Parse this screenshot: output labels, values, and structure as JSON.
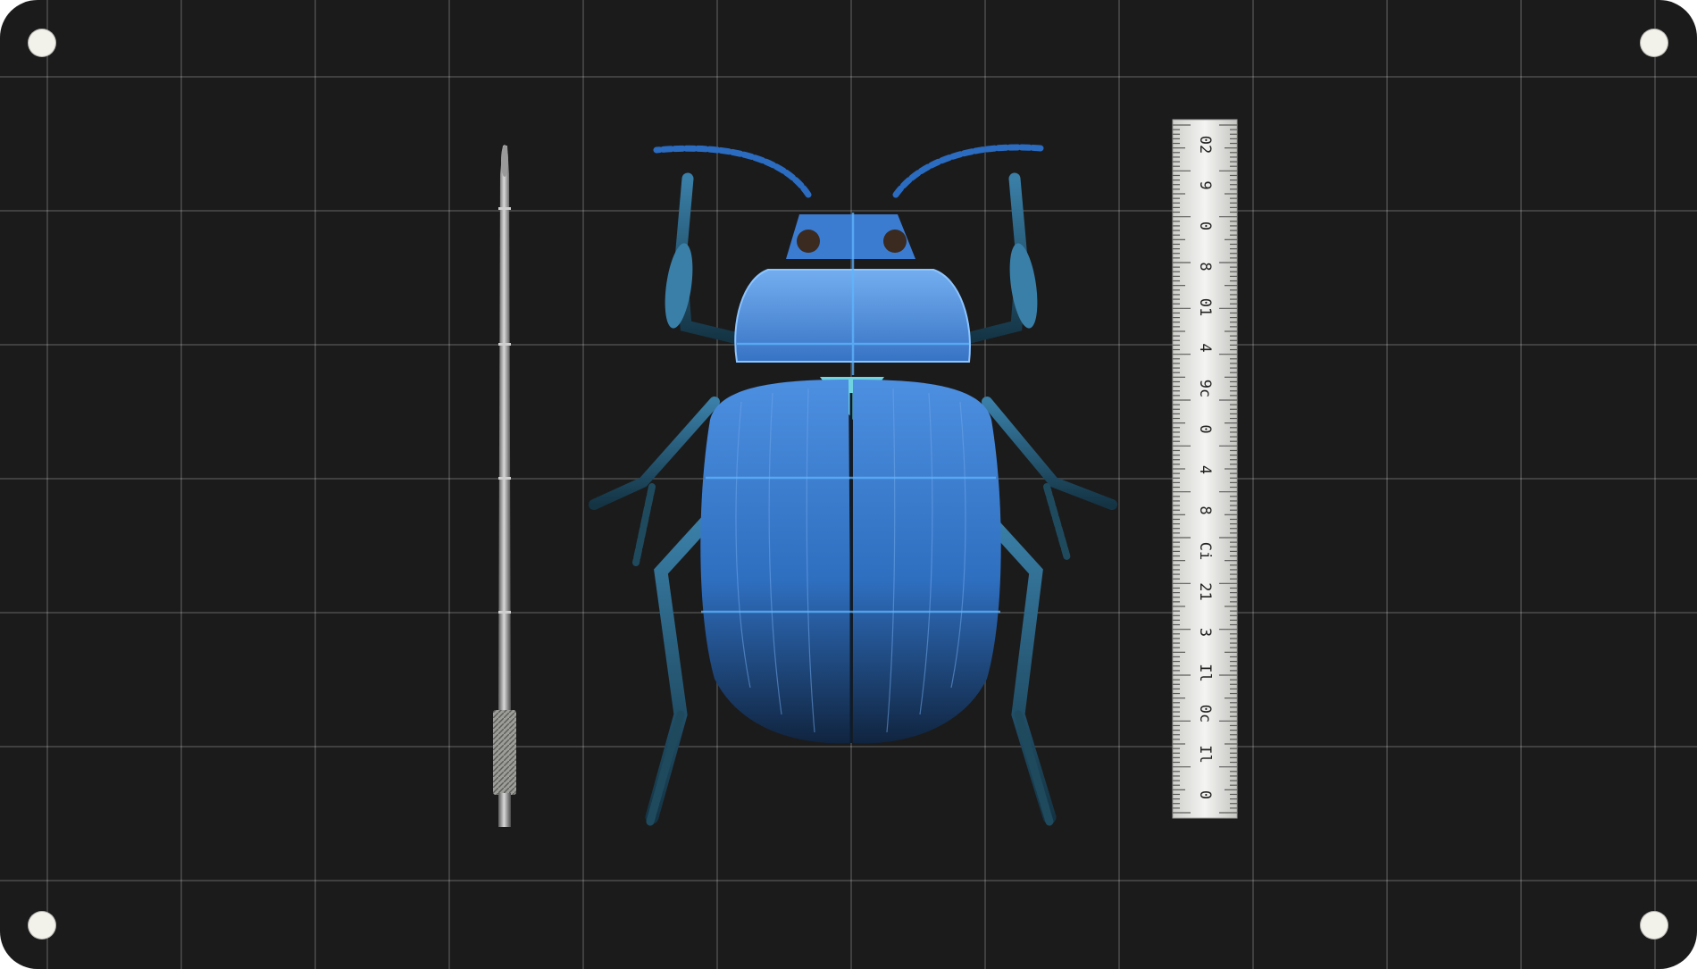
{
  "scene": {
    "subject": "blue-beetle-specimen",
    "board_color": "#1b1b1b",
    "grid_color": "#ffffff",
    "beetle_color": "#3a7fd0",
    "accent_color": "#6fd3e0",
    "icons": [
      "mounting-hole-icon",
      "specimen-pin-icon",
      "beetle-icon",
      "ruler-icon"
    ]
  },
  "ruler": {
    "labels": [
      "02",
      "9",
      "0",
      "8",
      "01",
      "4",
      "9c",
      "0",
      "4",
      "8",
      "Ci",
      "21",
      "3",
      "Il",
      "0c",
      "Il",
      "0"
    ]
  }
}
